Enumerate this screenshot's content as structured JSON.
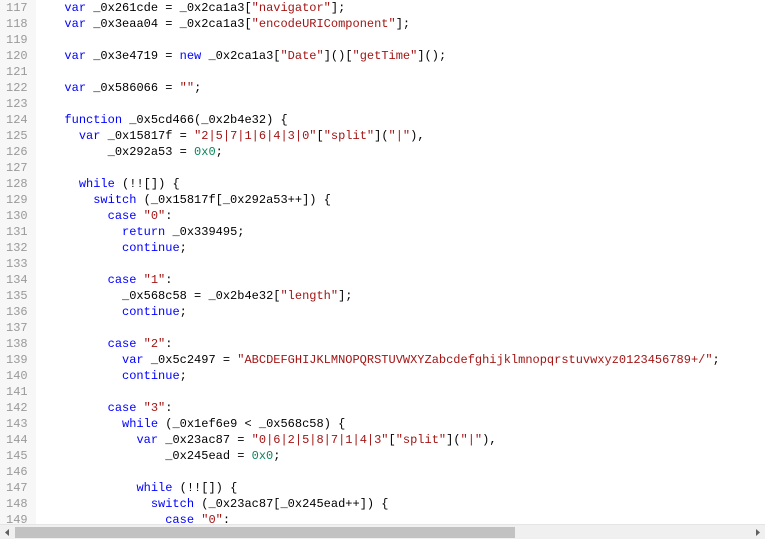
{
  "gutter": {
    "start": 117,
    "end": 149
  },
  "scrollbar": {
    "thumb_left_pct": 0,
    "thumb_width_pct": 68
  },
  "lines": [
    {
      "indent": 2,
      "tokens": [
        [
          "kw",
          "var"
        ],
        [
          "sp",
          " "
        ],
        [
          "id",
          "_0x261cde"
        ],
        [
          "sp",
          " "
        ],
        [
          "op",
          "="
        ],
        [
          "sp",
          " "
        ],
        [
          "id",
          "_0x2ca1a3"
        ],
        [
          "pun",
          "["
        ],
        [
          "str",
          "\"navigator\""
        ],
        [
          "pun",
          "]"
        ],
        [
          "pun",
          ";"
        ]
      ]
    },
    {
      "indent": 2,
      "tokens": [
        [
          "kw",
          "var"
        ],
        [
          "sp",
          " "
        ],
        [
          "id",
          "_0x3eaa04"
        ],
        [
          "sp",
          " "
        ],
        [
          "op",
          "="
        ],
        [
          "sp",
          " "
        ],
        [
          "id",
          "_0x2ca1a3"
        ],
        [
          "pun",
          "["
        ],
        [
          "str",
          "\"encodeURIComponent\""
        ],
        [
          "pun",
          "]"
        ],
        [
          "pun",
          ";"
        ]
      ]
    },
    {
      "indent": 0,
      "tokens": []
    },
    {
      "indent": 2,
      "tokens": [
        [
          "kw",
          "var"
        ],
        [
          "sp",
          " "
        ],
        [
          "id",
          "_0x3e4719"
        ],
        [
          "sp",
          " "
        ],
        [
          "op",
          "="
        ],
        [
          "sp",
          " "
        ],
        [
          "kw",
          "new"
        ],
        [
          "sp",
          " "
        ],
        [
          "id",
          "_0x2ca1a3"
        ],
        [
          "pun",
          "["
        ],
        [
          "str",
          "\"Date\""
        ],
        [
          "pun",
          "]"
        ],
        [
          "pun",
          "()"
        ],
        [
          "pun",
          "["
        ],
        [
          "str",
          "\"getTime\""
        ],
        [
          "pun",
          "]"
        ],
        [
          "pun",
          "()"
        ],
        [
          "pun",
          ";"
        ]
      ]
    },
    {
      "indent": 0,
      "tokens": []
    },
    {
      "indent": 2,
      "tokens": [
        [
          "kw",
          "var"
        ],
        [
          "sp",
          " "
        ],
        [
          "id",
          "_0x586066"
        ],
        [
          "sp",
          " "
        ],
        [
          "op",
          "="
        ],
        [
          "sp",
          " "
        ],
        [
          "str",
          "\"\""
        ],
        [
          "pun",
          ";"
        ]
      ]
    },
    {
      "indent": 0,
      "tokens": []
    },
    {
      "indent": 2,
      "tokens": [
        [
          "kw",
          "function"
        ],
        [
          "sp",
          " "
        ],
        [
          "fn",
          "_0x5cd466"
        ],
        [
          "pun",
          "("
        ],
        [
          "id",
          "_0x2b4e32"
        ],
        [
          "pun",
          ")"
        ],
        [
          "sp",
          " "
        ],
        [
          "pun",
          "{"
        ]
      ]
    },
    {
      "indent": 3,
      "tokens": [
        [
          "kw",
          "var"
        ],
        [
          "sp",
          " "
        ],
        [
          "id",
          "_0x15817f"
        ],
        [
          "sp",
          " "
        ],
        [
          "op",
          "="
        ],
        [
          "sp",
          " "
        ],
        [
          "str",
          "\"2|5|7|1|6|4|3|0\""
        ],
        [
          "pun",
          "["
        ],
        [
          "str",
          "\"split\""
        ],
        [
          "pun",
          "]"
        ],
        [
          "pun",
          "("
        ],
        [
          "str",
          "\"|\""
        ],
        [
          "pun",
          ")"
        ],
        [
          "pun",
          ","
        ]
      ]
    },
    {
      "indent": 5,
      "tokens": [
        [
          "id",
          "_0x292a53"
        ],
        [
          "sp",
          " "
        ],
        [
          "op",
          "="
        ],
        [
          "sp",
          " "
        ],
        [
          "num",
          "0x0"
        ],
        [
          "pun",
          ";"
        ]
      ]
    },
    {
      "indent": 0,
      "tokens": []
    },
    {
      "indent": 3,
      "tokens": [
        [
          "kw",
          "while"
        ],
        [
          "sp",
          " "
        ],
        [
          "pun",
          "("
        ],
        [
          "op",
          "!!"
        ],
        [
          "pun",
          "[]"
        ],
        [
          "pun",
          ")"
        ],
        [
          "sp",
          " "
        ],
        [
          "pun",
          "{"
        ]
      ]
    },
    {
      "indent": 4,
      "tokens": [
        [
          "kw",
          "switch"
        ],
        [
          "sp",
          " "
        ],
        [
          "pun",
          "("
        ],
        [
          "id",
          "_0x15817f"
        ],
        [
          "pun",
          "["
        ],
        [
          "id",
          "_0x292a53"
        ],
        [
          "op",
          "++"
        ],
        [
          "pun",
          "]"
        ],
        [
          "pun",
          ")"
        ],
        [
          "sp",
          " "
        ],
        [
          "pun",
          "{"
        ]
      ]
    },
    {
      "indent": 5,
      "tokens": [
        [
          "kw",
          "case"
        ],
        [
          "sp",
          " "
        ],
        [
          "str",
          "\"0\""
        ],
        [
          "pun",
          ":"
        ]
      ]
    },
    {
      "indent": 6,
      "tokens": [
        [
          "kw",
          "return"
        ],
        [
          "sp",
          " "
        ],
        [
          "id",
          "_0x339495"
        ],
        [
          "pun",
          ";"
        ]
      ]
    },
    {
      "indent": 6,
      "tokens": [
        [
          "kw",
          "continue"
        ],
        [
          "pun",
          ";"
        ]
      ]
    },
    {
      "indent": 0,
      "tokens": []
    },
    {
      "indent": 5,
      "tokens": [
        [
          "kw",
          "case"
        ],
        [
          "sp",
          " "
        ],
        [
          "str",
          "\"1\""
        ],
        [
          "pun",
          ":"
        ]
      ]
    },
    {
      "indent": 6,
      "tokens": [
        [
          "id",
          "_0x568c58"
        ],
        [
          "sp",
          " "
        ],
        [
          "op",
          "="
        ],
        [
          "sp",
          " "
        ],
        [
          "id",
          "_0x2b4e32"
        ],
        [
          "pun",
          "["
        ],
        [
          "str",
          "\"length\""
        ],
        [
          "pun",
          "]"
        ],
        [
          "pun",
          ";"
        ]
      ]
    },
    {
      "indent": 6,
      "tokens": [
        [
          "kw",
          "continue"
        ],
        [
          "pun",
          ";"
        ]
      ]
    },
    {
      "indent": 0,
      "tokens": []
    },
    {
      "indent": 5,
      "tokens": [
        [
          "kw",
          "case"
        ],
        [
          "sp",
          " "
        ],
        [
          "str",
          "\"2\""
        ],
        [
          "pun",
          ":"
        ]
      ]
    },
    {
      "indent": 6,
      "tokens": [
        [
          "kw",
          "var"
        ],
        [
          "sp",
          " "
        ],
        [
          "id",
          "_0x5c2497"
        ],
        [
          "sp",
          " "
        ],
        [
          "op",
          "="
        ],
        [
          "sp",
          " "
        ],
        [
          "str",
          "\"ABCDEFGHIJKLMNOPQRSTUVWXYZabcdefghijklmnopqrstuvwxyz0123456789+/\""
        ],
        [
          "pun",
          ";"
        ]
      ]
    },
    {
      "indent": 6,
      "tokens": [
        [
          "kw",
          "continue"
        ],
        [
          "pun",
          ";"
        ]
      ]
    },
    {
      "indent": 0,
      "tokens": []
    },
    {
      "indent": 5,
      "tokens": [
        [
          "kw",
          "case"
        ],
        [
          "sp",
          " "
        ],
        [
          "str",
          "\"3\""
        ],
        [
          "pun",
          ":"
        ]
      ]
    },
    {
      "indent": 6,
      "tokens": [
        [
          "kw",
          "while"
        ],
        [
          "sp",
          " "
        ],
        [
          "pun",
          "("
        ],
        [
          "id",
          "_0x1ef6e9"
        ],
        [
          "sp",
          " "
        ],
        [
          "op",
          "<"
        ],
        [
          "sp",
          " "
        ],
        [
          "id",
          "_0x568c58"
        ],
        [
          "pun",
          ")"
        ],
        [
          "sp",
          " "
        ],
        [
          "pun",
          "{"
        ]
      ]
    },
    {
      "indent": 7,
      "tokens": [
        [
          "kw",
          "var"
        ],
        [
          "sp",
          " "
        ],
        [
          "id",
          "_0x23ac87"
        ],
        [
          "sp",
          " "
        ],
        [
          "op",
          "="
        ],
        [
          "sp",
          " "
        ],
        [
          "str",
          "\"0|6|2|5|8|7|1|4|3\""
        ],
        [
          "pun",
          "["
        ],
        [
          "str",
          "\"split\""
        ],
        [
          "pun",
          "]"
        ],
        [
          "pun",
          "("
        ],
        [
          "str",
          "\"|\""
        ],
        [
          "pun",
          ")"
        ],
        [
          "pun",
          ","
        ]
      ]
    },
    {
      "indent": 9,
      "tokens": [
        [
          "id",
          "_0x245ead"
        ],
        [
          "sp",
          " "
        ],
        [
          "op",
          "="
        ],
        [
          "sp",
          " "
        ],
        [
          "num",
          "0x0"
        ],
        [
          "pun",
          ";"
        ]
      ]
    },
    {
      "indent": 0,
      "tokens": []
    },
    {
      "indent": 7,
      "tokens": [
        [
          "kw",
          "while"
        ],
        [
          "sp",
          " "
        ],
        [
          "pun",
          "("
        ],
        [
          "op",
          "!!"
        ],
        [
          "pun",
          "[]"
        ],
        [
          "pun",
          ")"
        ],
        [
          "sp",
          " "
        ],
        [
          "pun",
          "{"
        ]
      ]
    },
    {
      "indent": 8,
      "tokens": [
        [
          "kw",
          "switch"
        ],
        [
          "sp",
          " "
        ],
        [
          "pun",
          "("
        ],
        [
          "id",
          "_0x23ac87"
        ],
        [
          "pun",
          "["
        ],
        [
          "id",
          "_0x245ead"
        ],
        [
          "op",
          "++"
        ],
        [
          "pun",
          "]"
        ],
        [
          "pun",
          ")"
        ],
        [
          "sp",
          " "
        ],
        [
          "pun",
          "{"
        ]
      ]
    },
    {
      "indent": 9,
      "tokens": [
        [
          "kw",
          "case"
        ],
        [
          "sp",
          " "
        ],
        [
          "str",
          "\"0\""
        ],
        [
          "pun",
          ":"
        ]
      ]
    }
  ]
}
